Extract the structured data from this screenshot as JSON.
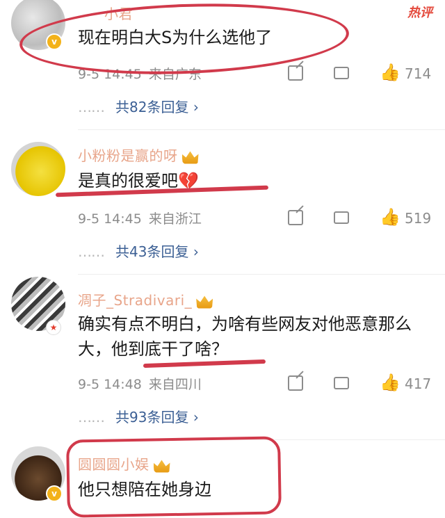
{
  "header": {
    "hot_label": "热评"
  },
  "comments": [
    {
      "username": "小君",
      "text": "现在明白大S为什么选他了",
      "date": "9-5 14:45",
      "location": "来自广东",
      "likes": "714",
      "replies": "共82条回复",
      "more_arrow": "›"
    },
    {
      "username": "小粉粉是赢的呀",
      "text": "是真的很爱吧💔",
      "date": "9-5 14:45",
      "location": "来自浙江",
      "likes": "519",
      "replies": "共43条回复",
      "more_arrow": "›"
    },
    {
      "username": "凋子_Stradivari_",
      "text": "确实有点不明白，为啥有些网友对他恶意那么大，他到底干了啥？",
      "date": "9-5 14:48",
      "location": "来自四川",
      "likes": "417",
      "replies": "共93条回复",
      "more_arrow": "›"
    },
    {
      "username": "圆圆圆小娱",
      "text": "他只想陪在她身边"
    }
  ],
  "dots": "……",
  "icons": {
    "edit": "edit-icon",
    "reply": "reply-icon",
    "like": "thumbs-up-icon",
    "verified": "verified-badge-icon",
    "crown": "crown-icon"
  },
  "colors": {
    "link": "#3b5f94",
    "meta": "#8c8c8c",
    "annotation": "#d13a4b",
    "hot": "#e44b3e"
  }
}
